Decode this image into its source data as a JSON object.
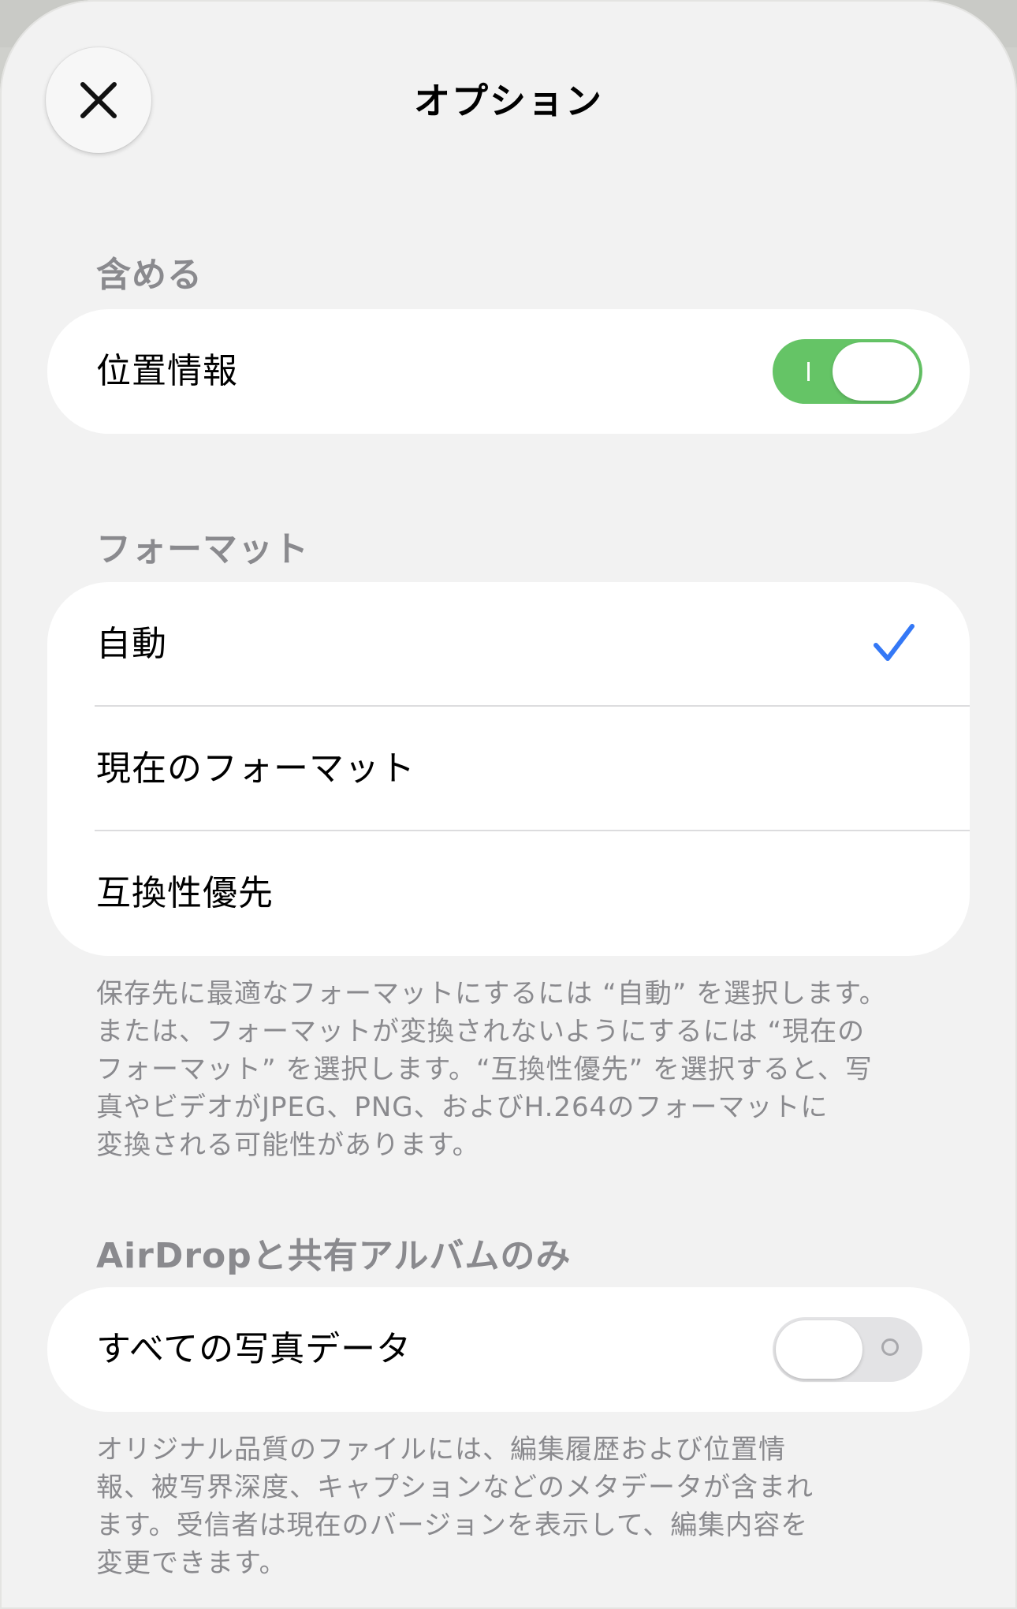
{
  "header": {
    "title": "オプション"
  },
  "include": {
    "header": "含める",
    "location_label": "位置情報",
    "location_on": true
  },
  "format": {
    "header": "フォーマット",
    "options": [
      {
        "label": "自動",
        "selected": true
      },
      {
        "label": "現在のフォーマット",
        "selected": false
      },
      {
        "label": "互換性優先",
        "selected": false
      }
    ],
    "footer_lines": [
      "保存先に最適なフォーマットにするには “自動” を選択します。",
      "または、フォーマットが変換されないようにするには “現在の",
      "フォーマット” を選択します。“互換性優先” を選択すると、写",
      "真やビデオがJPEG、PNG、およびH.264のフォーマットに",
      "変換される可能性があります。"
    ]
  },
  "airdrop": {
    "header": "AirDropと共有アルバムのみ",
    "all_photo_data_label": "すべての写真データ",
    "all_photo_data_on": false,
    "footer_lines": [
      "オリジナル品質のファイルには、編集履歴および位置情",
      "報、被写界深度、キャプションなどのメタデータが含まれ",
      "ます。受信者は現在のバージョンを表示して、編集内容を",
      "変更できます。"
    ]
  },
  "colors": {
    "toggle_on": "#65c466",
    "toggle_off": "#e3e3e5",
    "accent_check": "#3478f6",
    "secondary_text": "#8a8a8e",
    "sheet_background": "#f2f2f2"
  },
  "icons": {
    "close": "close-icon",
    "check": "checkmark-icon"
  }
}
